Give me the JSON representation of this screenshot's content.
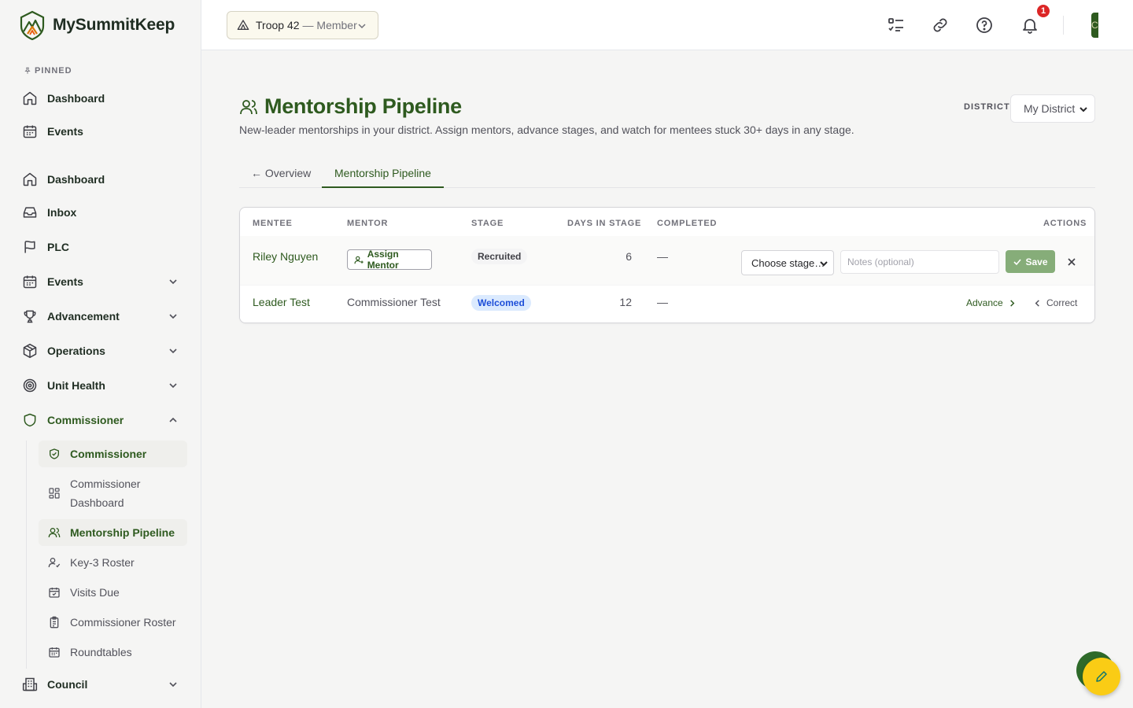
{
  "app": {
    "name": "MySummitKeep"
  },
  "sidebar": {
    "pinned_label": "PINNED",
    "pinned": [
      {
        "label": "Dashboard",
        "icon": "home-icon"
      },
      {
        "label": "Events",
        "icon": "calendar-icon"
      }
    ],
    "items": [
      {
        "label": "Dashboard",
        "icon": "home-icon"
      },
      {
        "label": "Inbox",
        "icon": "inbox-icon"
      },
      {
        "label": "PLC",
        "icon": "flag-icon"
      },
      {
        "label": "Events",
        "icon": "calendar-icon",
        "expandable": true
      },
      {
        "label": "Advancement",
        "icon": "trophy-icon",
        "expandable": true
      },
      {
        "label": "Operations",
        "icon": "box-icon",
        "expandable": true
      },
      {
        "label": "Unit Health",
        "icon": "target-icon",
        "expandable": true
      },
      {
        "label": "Commissioner",
        "icon": "shield-icon",
        "expanded": true
      },
      {
        "label": "Council",
        "icon": "building-icon",
        "expandable": true
      }
    ],
    "commissioner_sub": [
      {
        "label": "Commissioner",
        "icon": "shield-check-icon"
      },
      {
        "label": "Commissioner Dashboard",
        "icon": "layout-grid-icon"
      },
      {
        "label": "Mentorship Pipeline",
        "icon": "users-icon",
        "active": true
      },
      {
        "label": "Key-3 Roster",
        "icon": "user-check-icon"
      },
      {
        "label": "Visits Due",
        "icon": "calendar-check-icon"
      },
      {
        "label": "Commissioner Roster",
        "icon": "clipboard-icon"
      },
      {
        "label": "Roundtables",
        "icon": "calendar-grid-icon"
      }
    ]
  },
  "header": {
    "unit_name": "Troop 42",
    "unit_role": "— Member",
    "notification_count": "1",
    "avatar_initial": "C"
  },
  "page": {
    "title": "Mentorship Pipeline",
    "subtitle": "New-leader mentorships in your district. Assign mentors, advance stages, and watch for mentees stuck 30+ days in any stage.",
    "district_label": "DISTRICT",
    "district_value": "My District",
    "tabs": [
      {
        "label": "← Overview"
      },
      {
        "label": "Mentorship Pipeline",
        "active": true
      }
    ]
  },
  "table": {
    "headers": [
      "MENTEE",
      "MENTOR",
      "STAGE",
      "DAYS IN STAGE",
      "COMPLETED",
      "ACTIONS"
    ],
    "rows": [
      {
        "mentee": "Riley Nguyen",
        "mentor_button": "Assign Mentor",
        "stage": "Recruited",
        "days": "6",
        "completed": "—",
        "stage_select_placeholder": "Choose stage…",
        "notes_placeholder": "Notes (optional)",
        "save_label": "Save"
      },
      {
        "mentee": "Leader Test",
        "mentor": "Commissioner Test",
        "stage": "Welcomed",
        "days": "12",
        "completed": "—",
        "advance_label": "Advance",
        "correct_label": "Correct"
      }
    ]
  },
  "colors": {
    "brand_green": "#2e5a1f",
    "save_green": "#86ad79",
    "welcomed_blue": "#1d4ed8",
    "badge_red": "#dc2626",
    "fab_yellow": "#facc15"
  }
}
